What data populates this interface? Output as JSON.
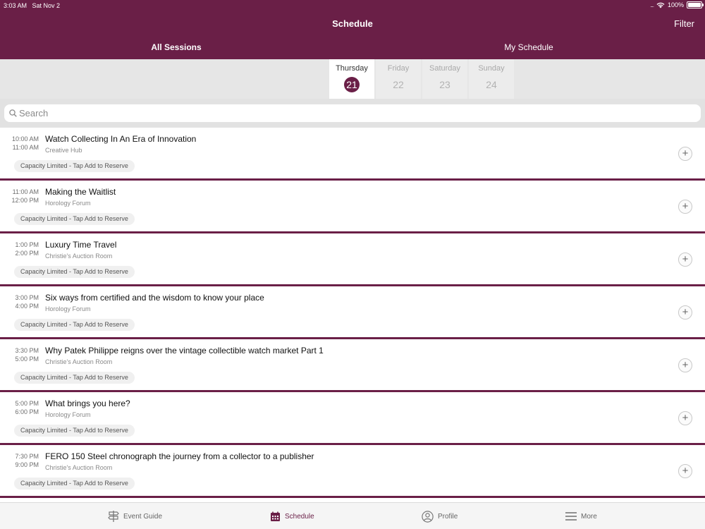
{
  "status": {
    "time": "3:03 AM",
    "date": "Sat Nov 2",
    "battery": "100%"
  },
  "nav": {
    "title": "Schedule",
    "filter": "Filter"
  },
  "segments": {
    "all": "All Sessions",
    "mine": "My Schedule"
  },
  "days": [
    {
      "name": "Thursday",
      "num": "21",
      "active": true
    },
    {
      "name": "Friday",
      "num": "22",
      "active": false
    },
    {
      "name": "Saturday",
      "num": "23",
      "active": false
    },
    {
      "name": "Sunday",
      "num": "24",
      "active": false
    }
  ],
  "search": {
    "placeholder": "Search"
  },
  "sessions": [
    {
      "start": "10:00 AM",
      "end": "11:00 AM",
      "title": "Watch Collecting In An Era of Innovation",
      "room": "Creative Hub",
      "tag": "Capacity Limited - Tap Add to Reserve"
    },
    {
      "start": "11:00 AM",
      "end": "12:00 PM",
      "title": "Making the Waitlist",
      "room": "Horology Forum",
      "tag": "Capacity Limited - Tap Add to Reserve"
    },
    {
      "start": "1:00 PM",
      "end": "2:00 PM",
      "title": "Luxury Time Travel",
      "room": "Christie's Auction Room",
      "tag": "Capacity Limited - Tap Add to Reserve"
    },
    {
      "start": "3:00 PM",
      "end": "4:00 PM",
      "title": "Six ways from certified and the wisdom to know your place",
      "room": "Horology Forum",
      "tag": "Capacity Limited - Tap Add to Reserve"
    },
    {
      "start": "3:30 PM",
      "end": "5:00 PM",
      "title": "Why Patek Philippe reigns over the vintage collectible watch market Part 1",
      "room": "Christie's Auction Room",
      "tag": "Capacity Limited - Tap Add to Reserve"
    },
    {
      "start": "5:00 PM",
      "end": "6:00 PM",
      "title": "What brings you here?",
      "room": "Horology Forum",
      "tag": "Capacity Limited - Tap Add to Reserve"
    },
    {
      "start": "7:30 PM",
      "end": "9:00 PM",
      "title": "FERO 150  Steel chronograph the journey from a collector to a publisher",
      "room": "Christie's Auction Room",
      "tag": "Capacity Limited - Tap Add to Reserve"
    }
  ],
  "tabs": {
    "guide": "Event Guide",
    "schedule": "Schedule",
    "profile": "Profile",
    "more": "More"
  },
  "colors": {
    "brand": "#6a1f47"
  }
}
